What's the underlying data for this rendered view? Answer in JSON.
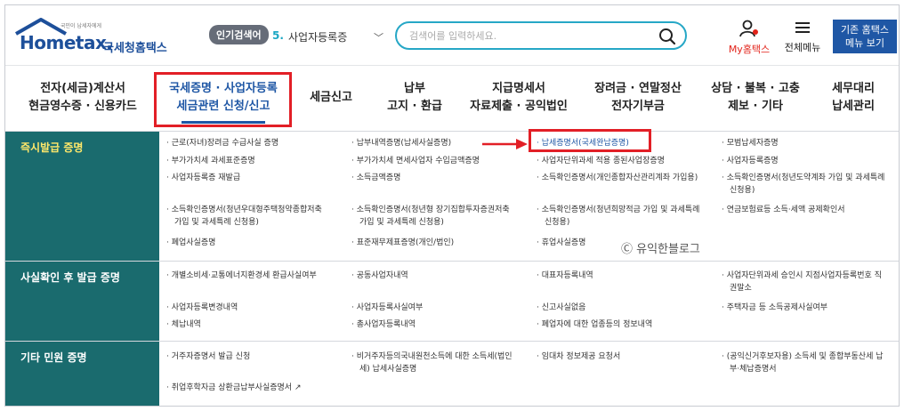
{
  "header": {
    "logo_small": "국민이 납세자에게",
    "logo_en": "Hometax.",
    "logo_ko": "국세청홈택스",
    "popular_badge": "인기검색어",
    "popular_rank": "5.",
    "popular_term": "사업자등록증",
    "search_placeholder": "검색어를 입력하세요.",
    "mytax_label": "My홈택스",
    "allmenu_label": "전체메뉴",
    "classic_line1": "기존 홈택스",
    "classic_line2": "메뉴 보기"
  },
  "nav": {
    "items": [
      {
        "line1": "전자(세금)계산서",
        "line2": "현금영수증 · 신용카드"
      },
      {
        "line1": "국세증명 · 사업자등록",
        "line2": "세금관련 신청/신고"
      },
      {
        "line1": "세금신고",
        "line2": ""
      },
      {
        "line1": "납부",
        "line2": "고지 · 환급"
      },
      {
        "line1": "지급명세서",
        "line2": "자료제출 · 공익법인"
      },
      {
        "line1": "장려금 · 연말정산",
        "line2": "전자기부금"
      },
      {
        "line1": "상담 · 불복 · 고충",
        "line2": "제보 · 기타"
      },
      {
        "line1": "세무대리",
        "line2": "납세관리"
      }
    ]
  },
  "sections": {
    "instant": {
      "title": "즉시발급 증명",
      "c1_1": "· 근로(자녀)장려금 수급사실 증명",
      "c1_2": "· 부가가치세 과세표준증명",
      "c1_3": "· 사업자등록증 재발급",
      "c1_4a": "· 소득확인증명서(청년우대형주택청약종합저축",
      "c1_4b": "가입 및 과세특례 신청용)",
      "c1_5": "· 폐업사실증명",
      "c2_1": "· 납부내역증명(납세사실증명)",
      "c2_2": "· 부가가치세 면세사업자 수입금액증명",
      "c2_3": "· 소득금액증명",
      "c2_4a": "· 소득확인증명서(청년형 장기집합투자증권저축",
      "c2_4b": "가입 및 과세특례 신청용)",
      "c2_5": "· 표준재무제표증명(개인/법인)",
      "c3_1": "· 납세증명서(국세완납증명)",
      "c3_2": "· 사업자단위과세 적용 종된사업장증명",
      "c3_3": "· 소득확인증명서(개인종합자산관리계좌 가입용)",
      "c3_4a": "· 소득확인증명서(청년희망적금 가입 및 과세특례",
      "c3_4b": "신청용)",
      "c3_5": "· 휴업사실증명",
      "c4_1": "· 모범납세자증명",
      "c4_2": "· 사업자등록증명",
      "c4_3a": "· 소득확인증명서(청년도약계좌 가입 및 과세특례",
      "c4_3b": "신청용)",
      "c4_4": "· 연금보험료등 소득·세액 공제확인서"
    },
    "confirm": {
      "title": "사실확인 후 발급 증명",
      "c1_1": "· 개별소비세·교통에너지환경세 환급사실여부",
      "c1_2": "· 사업자등록변경내역",
      "c1_3": "· 체납내역",
      "c2_1": "· 공동사업자내역",
      "c2_2": "· 사업자등록사실여부",
      "c2_3": "· 총사업자등록내역",
      "c3_1": "· 대표자등록내역",
      "c3_2": "· 신고사실없음",
      "c3_3": "· 폐업자에 대한 업종등의 정보내역",
      "c4_1a": "· 사업자단위과세 승인시 지점사업자등록번호 직",
      "c4_1b": "권말소",
      "c4_2": "· 주택자금 등 소득공제사실여부"
    },
    "other": {
      "title": "기타 민원 증명",
      "c1_1": "· 거주자증명서 발급 신청",
      "c1_2": "· 취업후학자금 상환금납부사실증명서",
      "c2_1a": "· 비거주자등의국내원천소득에 대한 소득세(법인",
      "c2_1b": "세) 납세사실증명",
      "c3_1": "· 임대차 정보제공 요청서",
      "c4_1a": "· (공익신거후보자용) 소득세 및 종합부동산세 납",
      "c4_1b": "부·체납증명서"
    }
  },
  "watermark": "Ⓒ 유익한블로그",
  "colors": {
    "accent_blue": "#1f57a5",
    "row_head_teal": "#1a6b6e",
    "highlight_red": "#e21f26",
    "search_border": "#26a7c6"
  }
}
